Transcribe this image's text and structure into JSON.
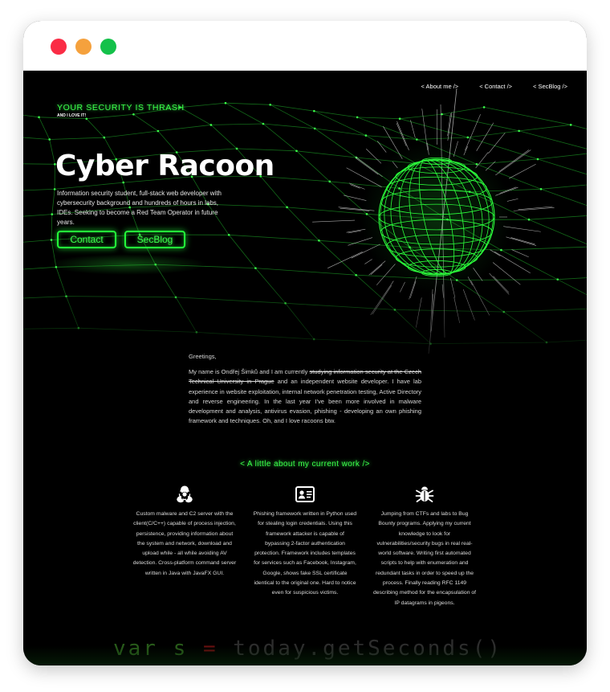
{
  "window": {
    "controls": [
      "close",
      "minimize",
      "maximize"
    ]
  },
  "nav": {
    "about": "< About me />",
    "contact": "< Contact />",
    "secblog": "< SecBlog />"
  },
  "hero": {
    "tagline": "YOUR SECURITY IS THRASH",
    "subtag": "AND I LOVE IT!",
    "title": "Cyber Racoon",
    "description": "Information security student, full-stack web developer with cybersecurity background and hundreds of hours in labs, IDEs. Seeking to become a Red Team Operator in future years.",
    "buttons": {
      "contact": "Contact",
      "secblog": "SecBlog"
    }
  },
  "about": {
    "greeting": "Greetings,",
    "intro_before": "My name is Ondřej Šimků and I am currently ",
    "intro_strike": "studying information security at the Czech Technical University in Prague",
    "intro_after": " and an independent website developer. I have lab experience in website exploitation, internal network penetration testing, Active Directory and reverse engineering. In the last year I've been more involved in malware development and analysis, antivirus evasion, phishing - developing an own phishing framework and techniques. Oh, and I love racoons btw."
  },
  "work": {
    "title": "< A little about my current work />",
    "cards": [
      {
        "icon": "biohazard-icon",
        "text": "Custom malware and C2 server with the client(C/C++) capable of process injection, persistence, providing information about the system and network, download and upload while - all while avoiding AV detection. Cross-platform command server written in Java with JavaFX GUI."
      },
      {
        "icon": "id-card-icon",
        "text": "Phishing framework written in Python used for stealing login credentials. Using this framework attacker is capable of bypassing 2-factor authentication protection. Framework includes templates for services such as Facebook, Instagram, Google, shows fake SSL certificate identical to the original one. Hard to notice even for suspicious victims."
      },
      {
        "icon": "bug-icon",
        "text": "Jumping from CTFs and labs to Bug Bounty programs. Applying my current knowledge to look for vulnerabilities/security bugs in real real-world software. Writing first automated scripts to help with enumeration and redundant tasks in order to speed up the process. Finally reading RFC 1149 describing method for the encapsulation of IP datagrams in pigeons."
      }
    ]
  },
  "background_code": {
    "kw": "var",
    "name": "s",
    "op": "=",
    "rest": "today.getSeconds()"
  },
  "colors": {
    "accent": "#3bff4b",
    "background": "#000000",
    "text": "#ffffff"
  }
}
